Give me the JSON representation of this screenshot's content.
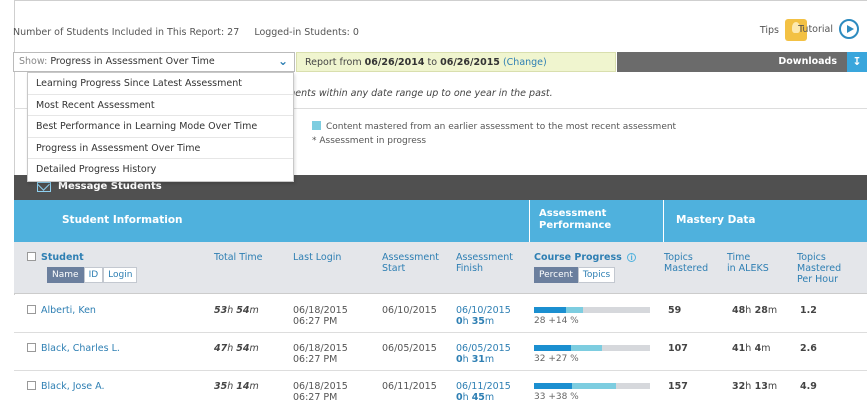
{
  "header": {
    "students_included": "Number of Students Included in This Report: 27",
    "logged_in": "Logged-in Students: 0",
    "tips": "Tips",
    "tutorial": "Tutorial"
  },
  "controls": {
    "show_label": "Show:",
    "show_value": "Progress in Assessment Over Time",
    "report_prefix": "Report from",
    "report_from": "06/26/2014",
    "report_to_word": "to",
    "report_to": "06/26/2015",
    "change": "(Change)",
    "downloads": "Downloads"
  },
  "dropdown": {
    "items": [
      "Learning Progress Since Latest Assessment",
      "Most Recent Assessment",
      "Best Performance in Learning Mode Over Time",
      "Progress in Assessment Over Time",
      "Detailed Progress History"
    ]
  },
  "notes": {
    "assess_text": "ments within any date range up to one year in the past.",
    "legend_mastered": "Content mastered from an earlier assessment to the most recent assessment",
    "legend_progress": "*  Assessment in progress"
  },
  "message_students": "Message Students",
  "table_header": {
    "student_info": "Student Information",
    "assessment_perf_1": "Assessment",
    "assessment_perf_2": "Performance",
    "mastery_data": "Mastery Data"
  },
  "columns": {
    "student": "Student",
    "sort_name": "Name",
    "sort_id": "ID",
    "sort_login": "Login",
    "total_time": "Total Time",
    "last_login": "Last Login",
    "assess_start_1": "Assessment",
    "assess_start_2": "Start",
    "assess_finish_1": "Assessment",
    "assess_finish_2": "Finish",
    "course_progress": "Course Progress",
    "percent": "Percent",
    "topics": "Topics",
    "topics_mastered_1": "Topics",
    "topics_mastered_2": "Mastered",
    "time_aleks_1": "Time",
    "time_aleks_2": "in ALEKS",
    "tmph_1": "Topics",
    "tmph_2": "Mastered",
    "tmph_3": "Per Hour"
  },
  "rows": [
    {
      "name": "Alberti, Ken",
      "total_h": "53",
      "total_m": "54",
      "login_date": "06/18/2015",
      "login_time": "06:27 PM",
      "start": "06/10/2015",
      "finish_date": "06/10/2015",
      "finish_h": "0",
      "finish_m": "35",
      "prior_pct": 28,
      "gain_pct": 14,
      "pct_text": "28 +14 %",
      "topics_mastered": "59",
      "aleks_h": "48",
      "aleks_m": "28",
      "per_hour": "1.2"
    },
    {
      "name": "Black, Charles L.",
      "total_h": "47",
      "total_m": "54",
      "login_date": "06/18/2015",
      "login_time": "06:27 PM",
      "start": "06/05/2015",
      "finish_date": "06/05/2015",
      "finish_h": "0",
      "finish_m": "31",
      "prior_pct": 32,
      "gain_pct": 27,
      "pct_text": "32 +27 %",
      "topics_mastered": "107",
      "aleks_h": "41",
      "aleks_m": "4",
      "per_hour": "2.6"
    },
    {
      "name": "Black, Jose A.",
      "total_h": "35",
      "total_m": "14",
      "login_date": "06/18/2015",
      "login_time": "06:27 PM",
      "start": "06/11/2015",
      "finish_date": "06/11/2015",
      "finish_h": "0",
      "finish_m": "45",
      "prior_pct": 33,
      "gain_pct": 38,
      "pct_text": "33 +38 %",
      "topics_mastered": "157",
      "aleks_h": "32",
      "aleks_m": "13",
      "per_hour": "4.9"
    }
  ],
  "units": {
    "h": "h",
    "m": "m"
  },
  "colors": {
    "accent_blue": "#4fb1dd",
    "link_blue": "#2e7fb3",
    "progress_dark": "#1b8fd0",
    "progress_light": "#7dcde0",
    "report_bg": "#f0f5cf",
    "bar_dark": "#505050"
  }
}
